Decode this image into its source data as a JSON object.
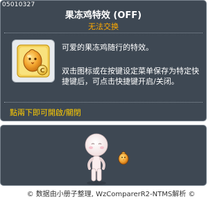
{
  "item": {
    "id": "05010327",
    "name": "果冻鸡特效 (OFF)",
    "trade_status": "无法交换",
    "description_line1": "可爱的果冻鸡随行的特效。",
    "description_line2": "双击图标或在按键设定菜单保存为特定快捷键后，可点击快捷键开启/关闭。",
    "hint": "點兩下即可開啟/關閉"
  },
  "colors": {
    "panel_bg": "#3e4853",
    "trade_status": "#ffaa00",
    "hint": "#ffcc00"
  },
  "icons": {
    "item_icon": "jelly-chick-icon",
    "character_preview": "character-avatar",
    "effect_preview": "jelly-chick-effect"
  },
  "footer": {
    "text": "© 数据由小册子整理, WzComparerR2-NTMS解析 ©"
  }
}
